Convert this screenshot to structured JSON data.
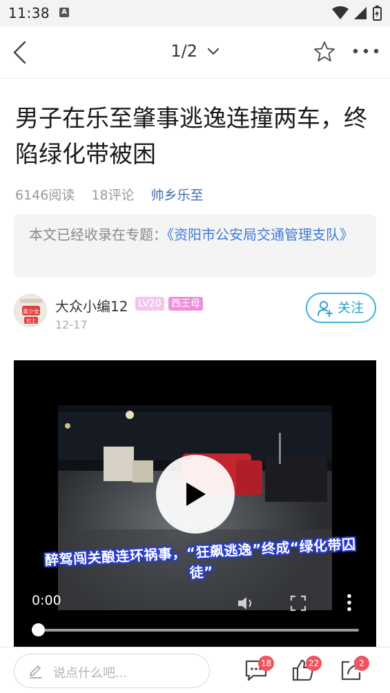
{
  "status_bar": {
    "time": "11:38",
    "notification_glyph": "A",
    "icons": [
      "notification-a-icon",
      "wifi-icon",
      "signal-icon",
      "battery-icon"
    ]
  },
  "nav": {
    "pager": "1/2",
    "icons": [
      "back-arrow-icon",
      "chevron-down-icon",
      "star-icon",
      "more-icon"
    ]
  },
  "article": {
    "title": "男子在乐至肇事逃逸连撞两车，终陷绿化带被困",
    "reads": "6146阅读",
    "comments": "18评论",
    "source": "帅乡乐至",
    "topic_prefix": "本文已经收录在专题：",
    "topic_link": "《资阳市公安局交通管理支队》"
  },
  "author": {
    "name": "大众小编12",
    "level": "LV20",
    "title_badge": "西王母",
    "date": "12-17",
    "avatar_text_top": "美少女",
    "avatar_text_bottom": "社士",
    "follow_label": "关注"
  },
  "video": {
    "caption": "醉驾闯关酿连环祸事，“狂飙逃逸”终成“绿化带囚徒”",
    "current_time": "0:00",
    "progress": 0,
    "icons": [
      "play-icon",
      "volume-icon",
      "fullscreen-icon",
      "more-vertical-icon"
    ]
  },
  "bottom_bar": {
    "comment_placeholder": "说点什么吧...",
    "comment_count": "18",
    "like_count": "22",
    "share_count": "2"
  },
  "colors": {
    "link": "#3f7ad6",
    "follow": "#3cb0d8",
    "badge_count": "#f0545d",
    "level_badge": "#f3c7ec",
    "title_badge": "#ee8fd8"
  }
}
